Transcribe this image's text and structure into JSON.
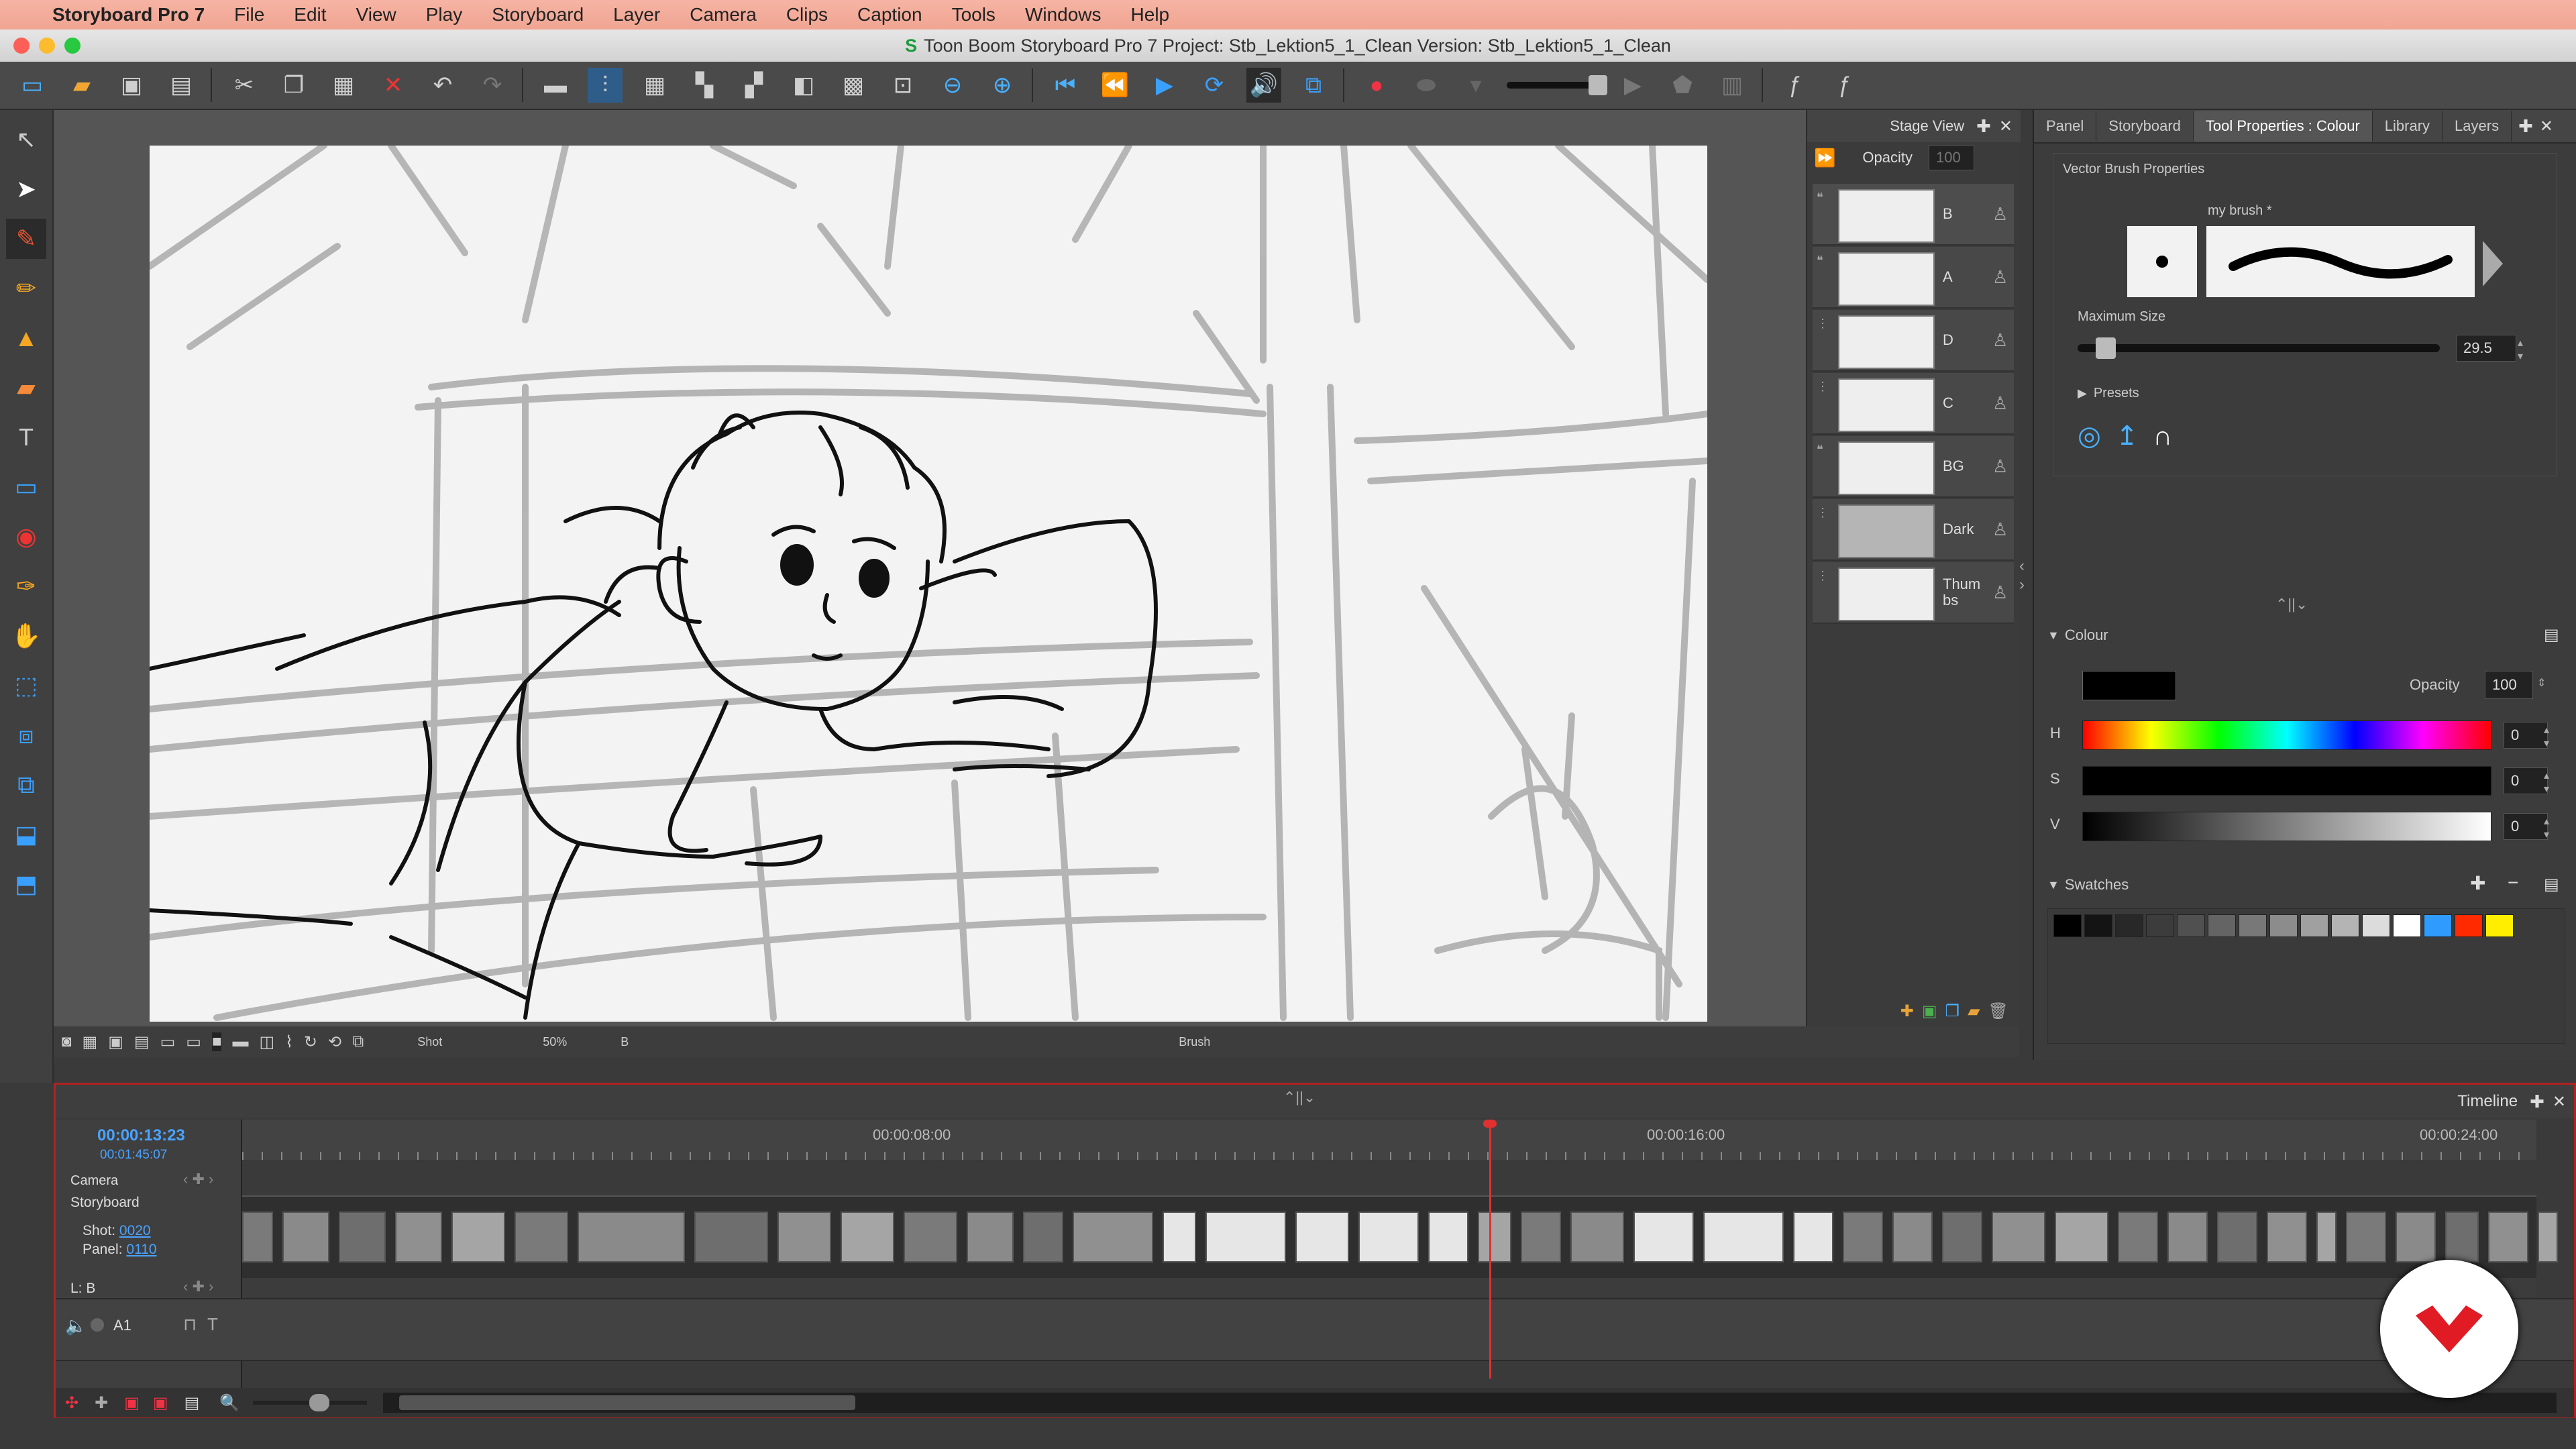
{
  "menubar": {
    "app_name": "Storyboard Pro 7",
    "items": [
      "File",
      "Edit",
      "View",
      "Play",
      "Storyboard",
      "Layer",
      "Camera",
      "Clips",
      "Caption",
      "Tools",
      "Windows",
      "Help"
    ]
  },
  "window": {
    "title": "Toon Boom Storyboard Pro 7 Project: Stb_Lektion5_1_Clean Version: Stb_Lektion5_1_Clean"
  },
  "stage": {
    "tab_label": "Stage View",
    "bottom_bar": {
      "zoom_mode": "Shot",
      "zoom_level": "50%",
      "layer": "B",
      "tool": "Brush"
    }
  },
  "layers": {
    "opacity_label": "Opacity",
    "opacity_value": "100",
    "items": [
      {
        "name": "B"
      },
      {
        "name": "A"
      },
      {
        "name": "D"
      },
      {
        "name": "C"
      },
      {
        "name": "BG"
      },
      {
        "name": "Dark"
      },
      {
        "name": "Thum bs"
      }
    ]
  },
  "right_panel": {
    "tabs": [
      "Panel",
      "Storyboard",
      "Tool Properties : Colour",
      "Library",
      "Layers"
    ],
    "active_tab": "Tool Properties : Colour",
    "brush": {
      "section_title": "Vector Brush Properties",
      "brush_name": "my brush *",
      "max_size_label": "Maximum Size",
      "max_size_value": "29.5",
      "max_size_fraction": 0.05,
      "presets_label": "Presets"
    },
    "colour": {
      "section_title": "Colour",
      "opacity_label": "Opacity",
      "opacity_value": "100",
      "h_label": "H",
      "h_value": "0",
      "s_label": "S",
      "s_value": "0",
      "v_label": "V",
      "v_value": "0",
      "current_color": "#000000"
    },
    "swatches": {
      "section_title": "Swatches",
      "colors": [
        "#000000",
        "#141414",
        "#282828",
        "#3c3c3c",
        "#505050",
        "#646464",
        "#787878",
        "#8c8c8c",
        "#a0a0a0",
        "#b4b4b4",
        "#dcdcdc",
        "#ffffff",
        "#2f9bff",
        "#ff2a00",
        "#ffee00"
      ]
    }
  },
  "timeline": {
    "tab_label": "Timeline",
    "current_time": "00:00:13:23",
    "total_time": "00:01:45:07",
    "ruler_labels": [
      "00:00:08:00",
      "00:00:16:00",
      "00:00:24:00"
    ],
    "camera_label": "Camera",
    "storyboard_label": "Storyboard",
    "shot_label": "Shot:",
    "shot_value": "0020",
    "panel_label": "Panel:",
    "panel_value": "0110",
    "layer_label": "L: B",
    "audio_track": "A1"
  },
  "colors": {
    "accent_red": "#b02222",
    "playhead": "#e03030",
    "link": "#4aa3ff"
  }
}
